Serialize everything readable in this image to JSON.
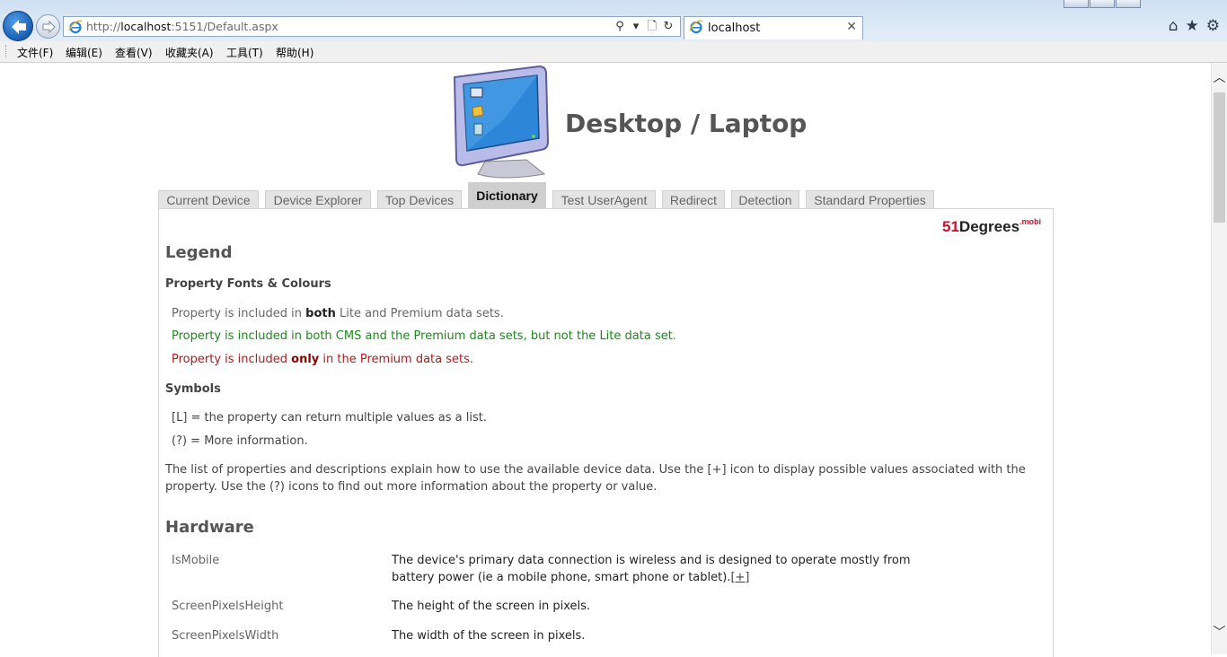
{
  "browser": {
    "url_host": "localhost",
    "url_rest": ":5151/Default.aspx",
    "url_scheme": "http://",
    "tab_title": "localhost",
    "tab_close": "✕",
    "addr_tools": [
      "⚲",
      "▾",
      "🗋",
      "↻"
    ],
    "right_icons": [
      "⌂",
      "★",
      "⚙"
    ]
  },
  "menu": [
    "文件(F)",
    "编辑(E)",
    "查看(V)",
    "收藏夹(A)",
    "工具(T)",
    "帮助(H)"
  ],
  "page": {
    "title": "Desktop / Laptop",
    "tabs": [
      "Current Device",
      "Device Explorer",
      "Top Devices",
      "Dictionary",
      "Test UserAgent",
      "Redirect",
      "Detection",
      "Standard Properties"
    ],
    "active_tab": "Dictionary",
    "logo": {
      "five": "51",
      "degrees": "Degrees",
      "mobi": ".mobi"
    },
    "legend": {
      "heading": "Legend",
      "fonts_heading": "Property Fonts & Colours",
      "both_pre": "Property is included in ",
      "both_bold": "both",
      "both_post": " Lite and Premium data sets.",
      "cms": "Property is included in both CMS and the Premium data sets, but not the Lite data set.",
      "only_pre": "Property is included ",
      "only_bold": "only",
      "only_post": " in the Premium data sets.",
      "symbols_heading": "Symbols",
      "symbol_list": "[L] = the property can return multiple values as a list.",
      "symbol_info": "(?) = More information.",
      "description": "The list of properties and descriptions explain how to use the available device data. Use the [+] icon to display possible values associated with the property. Use the (?) icons to find out more information about the property or value."
    },
    "hardware": {
      "heading": "Hardware",
      "properties": [
        {
          "name": "IsMobile",
          "desc": "The device's primary data connection is wireless and is designed to operate mostly from battery power (ie a mobile phone, smart phone or tablet).",
          "expand": "[+]"
        },
        {
          "name": "ScreenPixelsHeight",
          "desc": "The height of the screen in pixels."
        },
        {
          "name": "ScreenPixelsWidth",
          "desc": "The width of the screen in pixels."
        }
      ]
    }
  }
}
